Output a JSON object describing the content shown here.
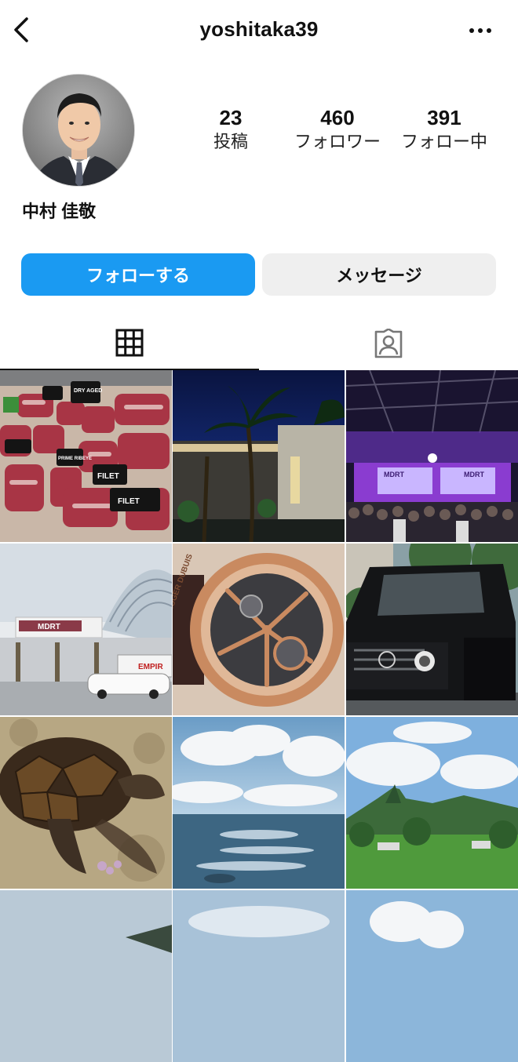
{
  "header": {
    "username": "yoshitaka39",
    "back_icon": "chevron-left-icon",
    "more_icon": "more-horizontal-icon"
  },
  "profile": {
    "display_name": "中村 佳敬",
    "stats": {
      "posts_count": "23",
      "posts_label": "投稿",
      "followers_count": "460",
      "followers_label": "フォロワー",
      "following_count": "391",
      "following_label": "フォロー中"
    }
  },
  "actions": {
    "follow_label": "フォローする",
    "message_label": "メッセージ"
  },
  "tabs": [
    {
      "icon": "grid-icon",
      "active": true
    },
    {
      "icon": "tagged-person-icon",
      "active": false
    }
  ],
  "colors": {
    "follow_button": "#1a9af2",
    "message_button": "#efefef"
  },
  "posts": [
    {
      "subject": "meat display",
      "labels": [
        "DRY AGED",
        "PRIME RIBEYE",
        "FILET",
        "FILET"
      ]
    },
    {
      "subject": "night hotel with palm trees"
    },
    {
      "subject": "conference stage",
      "labels": [
        "MDRT",
        "MDRT"
      ]
    },
    {
      "subject": "convention center",
      "labels": [
        "MDRT",
        "EMPIR"
      ]
    },
    {
      "subject": "skeleton watch",
      "labels": [
        "ROGER DUBUIS"
      ]
    },
    {
      "subject": "black SUV"
    },
    {
      "subject": "sea turtle"
    },
    {
      "subject": "ocean and sky"
    },
    {
      "subject": "green mountains"
    },
    {
      "subject": "partial sky"
    },
    {
      "subject": "partial sky"
    },
    {
      "subject": "partial clouds"
    }
  ]
}
